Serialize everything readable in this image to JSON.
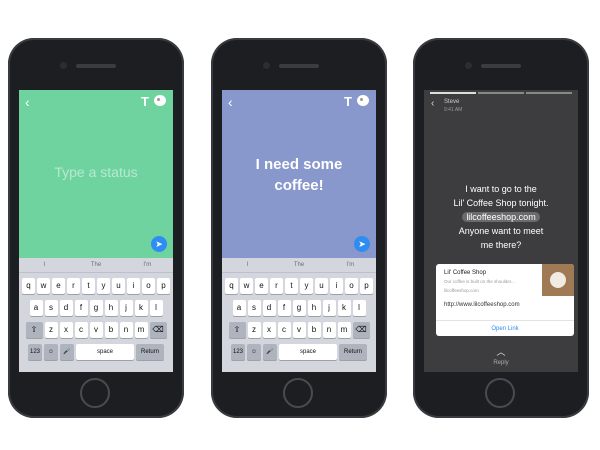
{
  "phones": [
    {
      "bg": "#6fd39f",
      "placeholder": "Type a status",
      "suggestions": [
        "I",
        "The",
        "I'm"
      ],
      "send_glyph": "➤"
    },
    {
      "bg": "#8897cc",
      "message_line1": "I need some",
      "message_line2": "coffee!",
      "suggestions": [
        "I",
        "The",
        "I'm"
      ],
      "send_glyph": "➤"
    },
    {
      "sender": "Steve",
      "time": "9:41 AM",
      "message_lines": [
        "I want to go to the",
        "Lil' Coffee Shop tonight.",
        "lilcoffeeshop.com",
        "Anyone want to meet",
        "me there?"
      ],
      "card": {
        "title": "Lil' Coffee Shop",
        "description": "Our coffee is built on the shoulder...",
        "site": "lilcoffeeshop.com",
        "url": "http://www.lilcoffeeshop.com",
        "open": "Open Link"
      },
      "reply": "Reply"
    }
  ],
  "keyboard": {
    "row1": [
      "q",
      "w",
      "e",
      "r",
      "t",
      "y",
      "u",
      "i",
      "o",
      "p"
    ],
    "row2": [
      "a",
      "s",
      "d",
      "f",
      "g",
      "h",
      "j",
      "k",
      "l"
    ],
    "row3": [
      "z",
      "x",
      "c",
      "v",
      "b",
      "n",
      "m"
    ],
    "numbers": "123",
    "space": "space",
    "return": "Return"
  },
  "icons": {
    "back": "‹",
    "text_tool": "T",
    "shift": "⇧",
    "backspace": "⌫",
    "emoji": "☺",
    "mic": "🎤"
  }
}
